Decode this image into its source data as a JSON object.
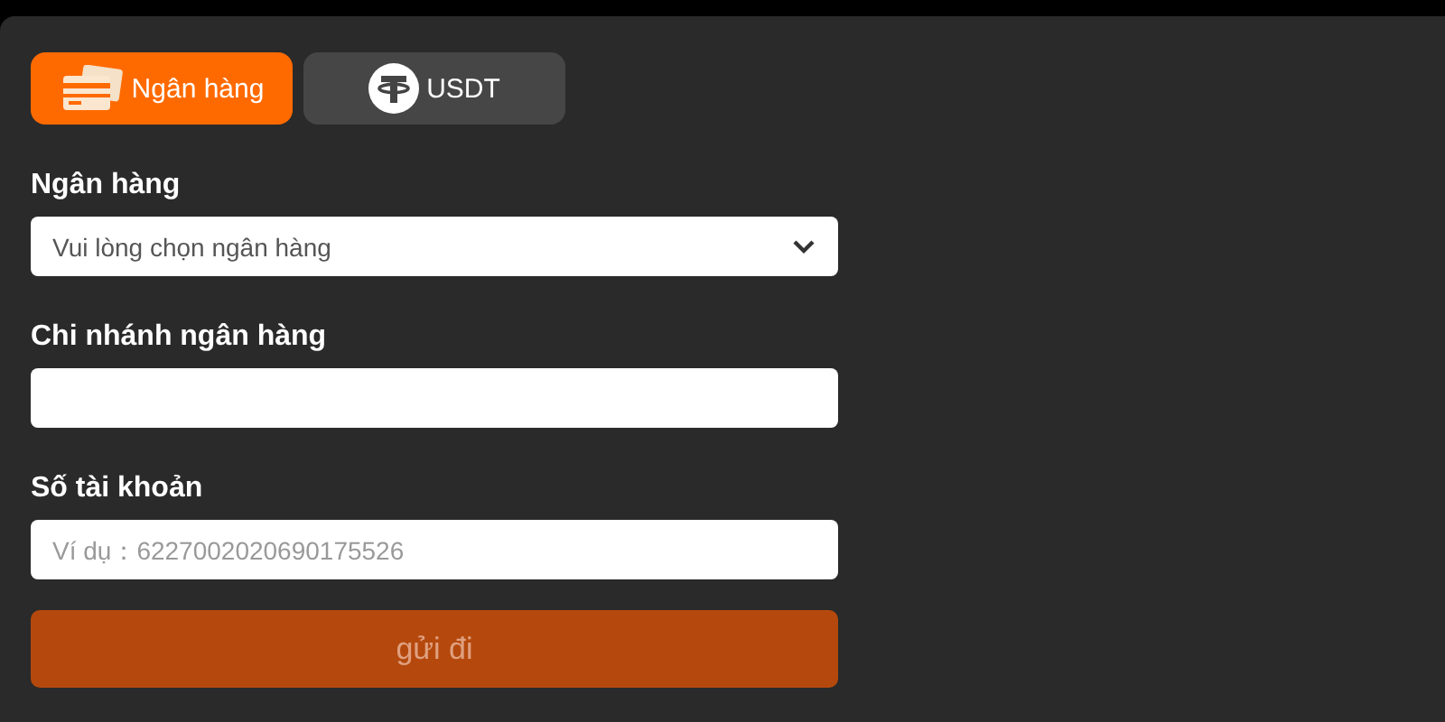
{
  "tabs": [
    {
      "label": "Ngân hàng",
      "kind": "card",
      "selected": true
    },
    {
      "label": "USDT",
      "kind": "tether",
      "selected": false
    }
  ],
  "fields": [
    {
      "label": "Ngân hàng",
      "kind": "select",
      "placeholder": "Vui lòng chọn ngân hàng"
    },
    {
      "label": "Chi nhánh ngân hàng",
      "kind": "text"
    },
    {
      "label": "Số tài khoản",
      "kind": "text",
      "placeholder": "Ví dụ：6227002020690175526"
    }
  ],
  "submit": {
    "label": "gửi đi",
    "disabled": true
  }
}
